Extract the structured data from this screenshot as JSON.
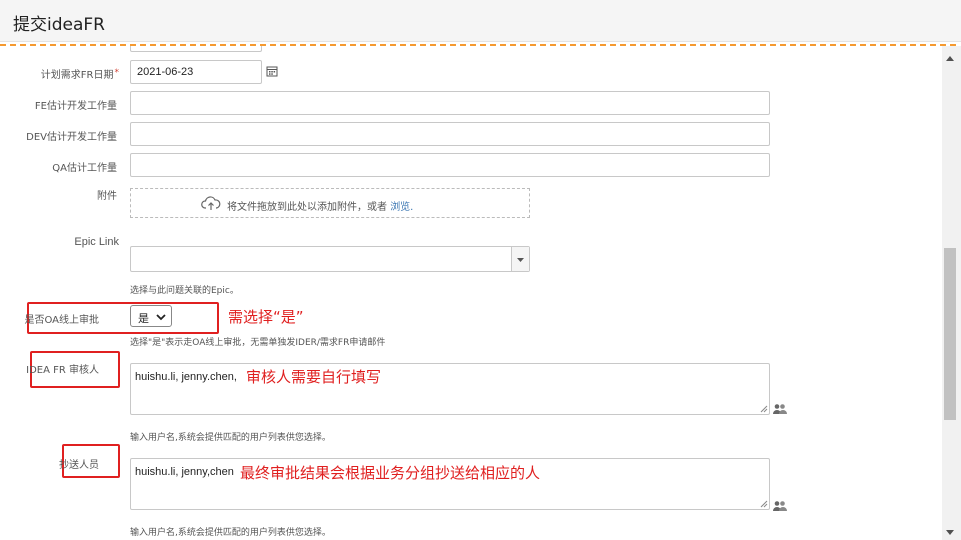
{
  "header": {
    "title": "提交ideaFR"
  },
  "form": {
    "planned_date": {
      "label": "计划需求FR日期",
      "required_mark": "*",
      "value": "2021-06-23"
    },
    "fe_estimate": {
      "label": "FE估计开发工作量",
      "value": ""
    },
    "dev_estimate": {
      "label": "DEV估计开发工作量",
      "value": ""
    },
    "qa_estimate": {
      "label": "QA估计工作量",
      "value": ""
    },
    "attachment": {
      "label": "附件",
      "drop_text": "将文件拖放到此处以添加附件，或者",
      "browse_link": "浏览."
    },
    "epic_link": {
      "label": "Epic Link",
      "value": "",
      "hint": "选择与此问题关联的Epic。"
    },
    "oa_approval": {
      "label": "是否OA线上审批",
      "selected": "是",
      "hint": "选择\"是\"表示走OA线上审批，无需单独发IDER/需求FR申请邮件"
    },
    "idea_reviewer": {
      "label": "IDEA FR 审核人",
      "value": "huishu.li, jenny.chen,",
      "hint": "输入用户名,系统会提供匹配的用户列表供您选择。"
    },
    "cc_people": {
      "label": "抄送人员",
      "value": "huishu.li, jenny,chen",
      "hint": "输入用户名,系统会提供匹配的用户列表供您选择。"
    }
  },
  "annotations": {
    "select_yes": "需选择“是”",
    "reviewer_note": "审核人需要自行填写",
    "cc_note": "最终审批结果会根据业务分组抄送给相应的人"
  },
  "colors": {
    "annotation_red": "#e02020",
    "dashed_orange": "#f59a30",
    "link_blue": "#3572b0"
  }
}
